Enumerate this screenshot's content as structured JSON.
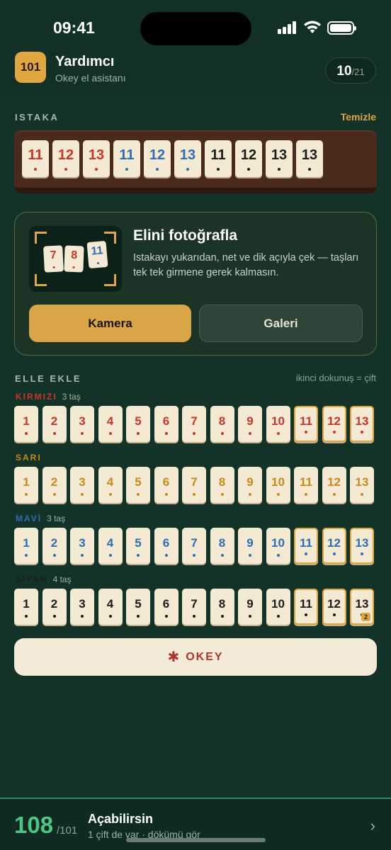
{
  "status": {
    "time": "09:41"
  },
  "header": {
    "logo": "101",
    "title": "Yardımcı",
    "subtitle": "Okey el asistanı",
    "count": "10",
    "count_total": "/21"
  },
  "rack": {
    "label": "ISTAKA",
    "clear": "Temizle",
    "tiles": [
      {
        "n": "11",
        "c": "red"
      },
      {
        "n": "12",
        "c": "red"
      },
      {
        "n": "13",
        "c": "red"
      },
      {
        "n": "11",
        "c": "blue"
      },
      {
        "n": "12",
        "c": "blue"
      },
      {
        "n": "13",
        "c": "blue"
      },
      {
        "n": "11",
        "c": "black"
      },
      {
        "n": "12",
        "c": "black"
      },
      {
        "n": "13",
        "c": "black"
      },
      {
        "n": "13",
        "c": "black"
      }
    ]
  },
  "photo": {
    "title": "Elini fotoğrafla",
    "desc": "Istakayı yukarıdan, net ve dik açıyla çek — taşları tek tek girmene gerek kalmasın.",
    "mini_tiles": [
      {
        "n": "7",
        "c": "red"
      },
      {
        "n": "8",
        "c": "red"
      },
      {
        "n": "11",
        "c": "blue"
      }
    ],
    "camera": "Kamera",
    "gallery": "Galeri"
  },
  "manual": {
    "label": "ELLE EKLE",
    "hint": "ikinci dokunuş = çift",
    "rows": [
      {
        "name": "KIRMIZI",
        "count": "3 taş",
        "c": "red",
        "selected": [
          11,
          12,
          13
        ],
        "badges": {}
      },
      {
        "name": "SARI",
        "count": "",
        "c": "yellow",
        "selected": [],
        "badges": {}
      },
      {
        "name": "MAVİ",
        "count": "3 taş",
        "c": "blue",
        "selected": [
          11,
          12,
          13
        ],
        "badges": {}
      },
      {
        "name": "SİYAH",
        "count": "4 taş",
        "c": "black",
        "selected": [
          11,
          12,
          13
        ],
        "badges": {
          "13": "2"
        }
      }
    ],
    "numbers": [
      "1",
      "2",
      "3",
      "4",
      "5",
      "6",
      "7",
      "8",
      "9",
      "10",
      "11",
      "12",
      "13"
    ]
  },
  "okey": {
    "star": "✱",
    "label": "OKEY"
  },
  "result": {
    "score": "108",
    "of": "/101",
    "title": "Açabilirsin",
    "subtitle": "1 çift de var · dökümü gör"
  },
  "colors": {
    "red": "#c9352a",
    "yellow": "#c98a1a",
    "blue": "#2f6db1",
    "black": "#1c1c1c",
    "accent": "#e0a63f",
    "score": "#4dc784"
  }
}
